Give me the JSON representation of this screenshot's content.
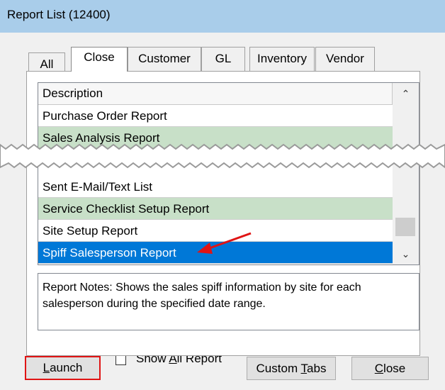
{
  "window": {
    "title": "Report List (12400)"
  },
  "tabs": [
    {
      "label": "All",
      "active": false
    },
    {
      "label": "Close",
      "active": true
    },
    {
      "label": "Customer",
      "active": false
    },
    {
      "label": "GL",
      "active": false
    },
    {
      "label": "Inventory",
      "active": false
    },
    {
      "label": "Vendor",
      "active": false
    }
  ],
  "list": {
    "header": "Description",
    "rows": [
      {
        "text": "Purchase Order Report",
        "style": "white"
      },
      {
        "text": "Sales Analysis Report",
        "style": "green"
      },
      {
        "text": "Sent E-Mail/Text List",
        "style": "white"
      },
      {
        "text": "Service Checklist Setup Report",
        "style": "green"
      },
      {
        "text": "Site Setup Report",
        "style": "white"
      },
      {
        "text": "Spiff Salesperson Report",
        "style": "selected"
      }
    ]
  },
  "notes": "Report Notes:  Shows the sales spiff information by site for each salesperson during the specified date range.",
  "buttons": {
    "launch": {
      "pre": "",
      "mnemonic": "L",
      "post": "aunch"
    },
    "custom_tabs": {
      "pre": "Custom ",
      "mnemonic": "T",
      "post": "abs"
    },
    "close": {
      "pre": "",
      "mnemonic": "C",
      "post": "lose"
    }
  },
  "show_all": {
    "pre": "Show ",
    "mnemonic": "A",
    "post": "ll Report",
    "checked": false
  },
  "colors": {
    "title_bar": "#a9cdea",
    "selection": "#0078d7",
    "alt_row": "#c8e0c8",
    "highlight_box": "#e01414",
    "arrow": "#e01414"
  },
  "icons": {
    "scroll_up": "chevron-up-icon",
    "scroll_down": "chevron-down-icon",
    "annotation": "red-arrow-icon"
  }
}
